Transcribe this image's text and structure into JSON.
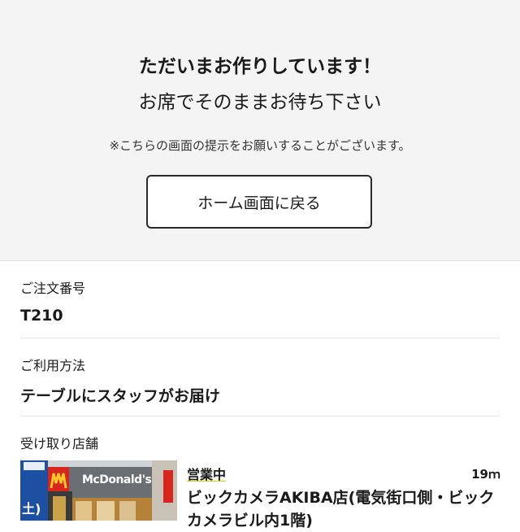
{
  "hero": {
    "title_line1": "ただいまお作りしています！",
    "title_line2": "お席でそのままお待ち下さい",
    "notice": "※こちらの画面の提示をお願いすることがございます。",
    "home_button_label": "ホーム画面に戻る"
  },
  "order": {
    "number_label": "ご注文番号",
    "number_value": "T210",
    "method_label": "ご利用方法",
    "method_value": "テーブルにスタッフがお届け",
    "store_label": "受け取り店舗"
  },
  "store": {
    "status": "営業中",
    "distance": "19ｍ",
    "name": "ビックカメラAKIBA店(電気街口側・ビックカメラビル内1階)",
    "photo_sign_text": "McDonald's",
    "photo_side_text": "土)",
    "colors": {
      "status_underline": "#c9d400",
      "mcd_red": "#d7261e",
      "mcd_yellow": "#ffc72c"
    }
  }
}
